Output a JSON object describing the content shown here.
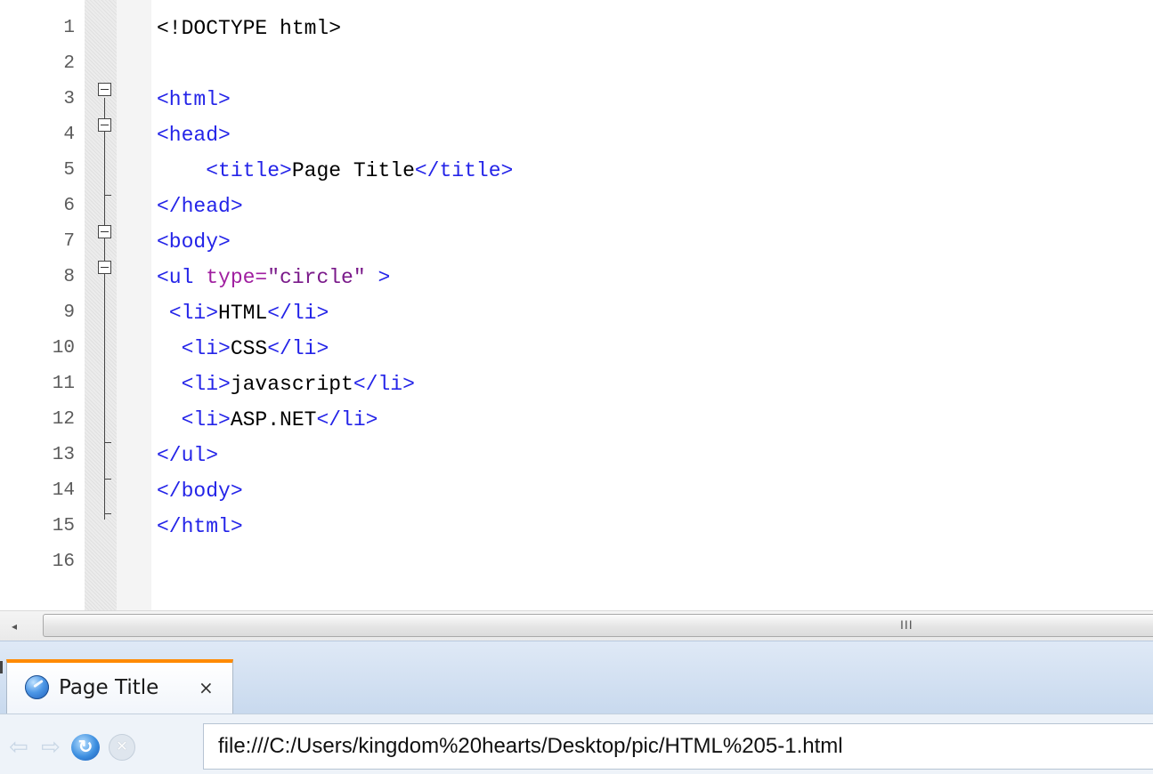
{
  "editor": {
    "line_numbers": [
      "1",
      "2",
      "3",
      "4",
      "5",
      "6",
      "7",
      "8",
      "9",
      "10",
      "11",
      "12",
      "13",
      "14",
      "15",
      "16"
    ],
    "lines": [
      [
        {
          "t": "doc",
          "s": "<!DOCTYPE html>"
        }
      ],
      [],
      [
        {
          "t": "tag",
          "s": "<html>"
        }
      ],
      [
        {
          "t": "tag",
          "s": "<head>"
        }
      ],
      [
        {
          "t": "txt",
          "s": "    "
        },
        {
          "t": "tag",
          "s": "<title>"
        },
        {
          "t": "txt",
          "s": "Page Title"
        },
        {
          "t": "tag",
          "s": "</title>"
        }
      ],
      [
        {
          "t": "tag",
          "s": "</head>"
        }
      ],
      [
        {
          "t": "tag",
          "s": "<body>"
        }
      ],
      [
        {
          "t": "tag",
          "s": "<ul "
        },
        {
          "t": "attr",
          "s": "type="
        },
        {
          "t": "str",
          "s": "\"circle\""
        },
        {
          "t": "tag",
          "s": " >"
        }
      ],
      [
        {
          "t": "txt",
          "s": " "
        },
        {
          "t": "tag",
          "s": "<li>"
        },
        {
          "t": "txt",
          "s": "HTML"
        },
        {
          "t": "tag",
          "s": "</li>"
        }
      ],
      [
        {
          "t": "txt",
          "s": "  "
        },
        {
          "t": "tag",
          "s": "<li>"
        },
        {
          "t": "txt",
          "s": "CSS"
        },
        {
          "t": "tag",
          "s": "</li>"
        }
      ],
      [
        {
          "t": "txt",
          "s": "  "
        },
        {
          "t": "tag",
          "s": "<li>"
        },
        {
          "t": "txt",
          "s": "javascript"
        },
        {
          "t": "tag",
          "s": "</li>"
        }
      ],
      [
        {
          "t": "txt",
          "s": "  "
        },
        {
          "t": "tag",
          "s": "<li>"
        },
        {
          "t": "txt",
          "s": "ASP.NET"
        },
        {
          "t": "tag",
          "s": "</li>"
        }
      ],
      [
        {
          "t": "tag",
          "s": "</ul>"
        }
      ],
      [
        {
          "t": "tag",
          "s": "</body>"
        }
      ],
      [
        {
          "t": "tag",
          "s": "</html>"
        }
      ],
      []
    ]
  },
  "scrollbar": {
    "left_arrow": "◂",
    "grip": "III"
  },
  "browser": {
    "tab": {
      "title": "Page Title",
      "close": "×"
    },
    "nav": {
      "back": "⇦",
      "forward": "⇨",
      "reload": "↻",
      "stop": "✕"
    },
    "address": "file:///C:/Users/kingdom%20hearts/Desktop/pic/HTML%205-1.html"
  },
  "colors": {
    "tag": "#2424e8",
    "attribute": "#a01fa0",
    "string": "#7a1a8a",
    "text": "#000000",
    "tab_accent": "#ff8a00"
  },
  "icons": [
    "fold-collapse-icon",
    "scroll-left-arrow-icon",
    "globe-favicon-icon",
    "close-icon",
    "back-arrow-icon",
    "forward-arrow-icon",
    "reload-icon",
    "stop-icon"
  ]
}
